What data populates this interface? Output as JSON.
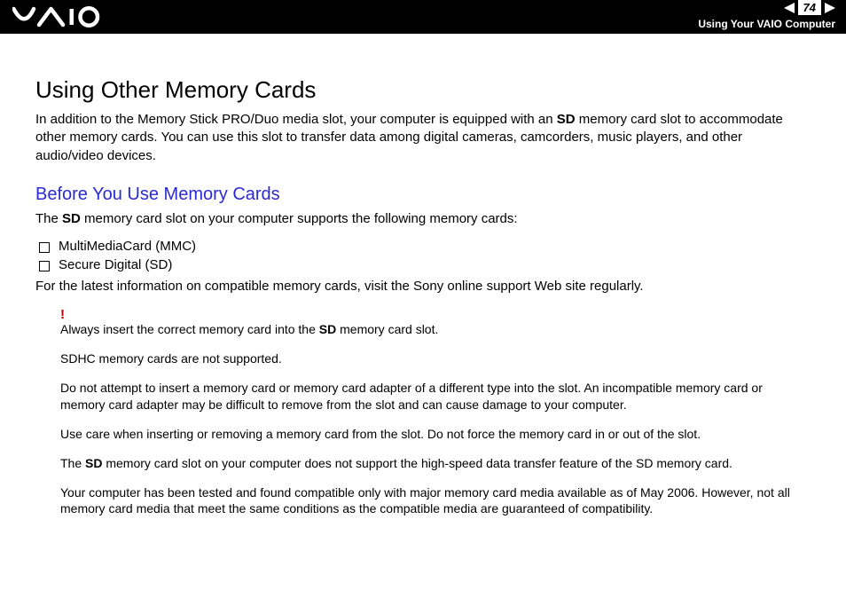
{
  "header": {
    "page_number": "74",
    "section": "Using Your VAIO Computer",
    "logo_alt": "VAIO"
  },
  "title": "Using Other Memory Cards",
  "intro_pre": "In addition to the Memory Stick PRO/Duo media slot, your computer is equipped with an ",
  "intro_bold": "SD",
  "intro_post": " memory card slot to accommodate other memory cards. You can use this slot to transfer data among digital cameras, camcorders, music players, and other audio/video devices.",
  "subhead": "Before You Use Memory Cards",
  "support_pre": "The ",
  "support_bold": "SD",
  "support_post": " memory card slot on your computer supports the following memory cards:",
  "bullets": [
    "MultiMediaCard (MMC)",
    "Secure Digital (SD)"
  ],
  "latest": "For the latest information on compatible memory cards, visit the Sony online support Web site regularly.",
  "bang": "!",
  "n1_pre": "Always insert the correct memory card into the ",
  "n1_bold": "SD",
  "n1_post": " memory card slot.",
  "n2": "SDHC memory cards are not supported.",
  "n3": "Do not attempt to insert a memory card or memory card adapter of a different type into the slot. An incompatible memory card or memory card adapter may be difficult to remove from the slot and can cause damage to your computer.",
  "n4": "Use care when inserting or removing a memory card from the slot. Do not force the memory card in or out of the slot.",
  "n5_pre": "The ",
  "n5_bold": "SD",
  "n5_post": " memory card slot on your computer does not support the high-speed data transfer feature of the SD memory card.",
  "n6": "Your computer has been tested and found compatible only with major memory card media available as of May 2006. However, not all memory card media that meet the same conditions as the compatible media are guaranteed of compatibility."
}
